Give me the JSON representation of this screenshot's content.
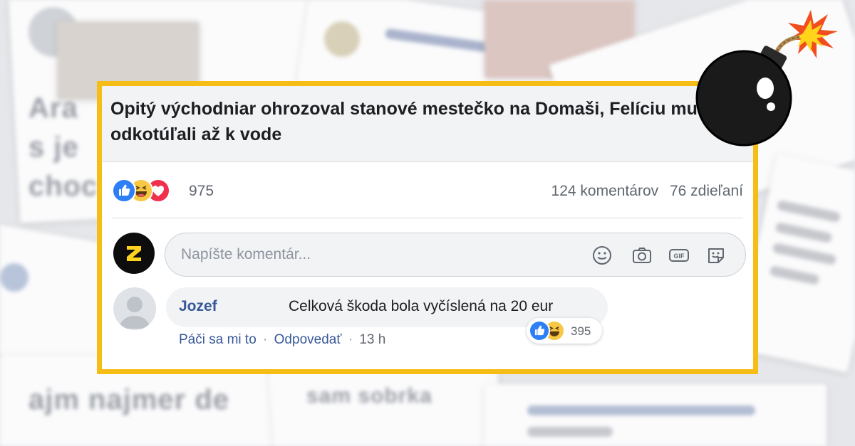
{
  "post": {
    "headline": "Opitý východniar ohrozoval stanové mestečko na Domaši, Felíciu mu odkotúľali až k vode",
    "reaction_icons": [
      "like-icon",
      "haha-icon",
      "love-icon"
    ],
    "reaction_count": "975",
    "comments_count": "124 komentárov",
    "shares_count": "76 zdieľaní"
  },
  "composer": {
    "placeholder": "Napíšte komentár...",
    "tools": [
      "emoji-icon",
      "camera-icon",
      "gif-icon",
      "sticker-icon"
    ]
  },
  "comment": {
    "author": "Jozef",
    "text": "Celková škoda bola vyčíslená na 20 eur",
    "like_action": "Páči sa mi to",
    "separator": "·",
    "reply_action": "Odpovedať",
    "time": "13 h",
    "reaction_icons": [
      "like-icon",
      "haha-icon"
    ],
    "reaction_count": "395"
  },
  "colors": {
    "frame": "#f5bd16",
    "link": "#385898",
    "like": "#2d7ff6",
    "haha": "#f7c844",
    "love": "#f0304c"
  }
}
